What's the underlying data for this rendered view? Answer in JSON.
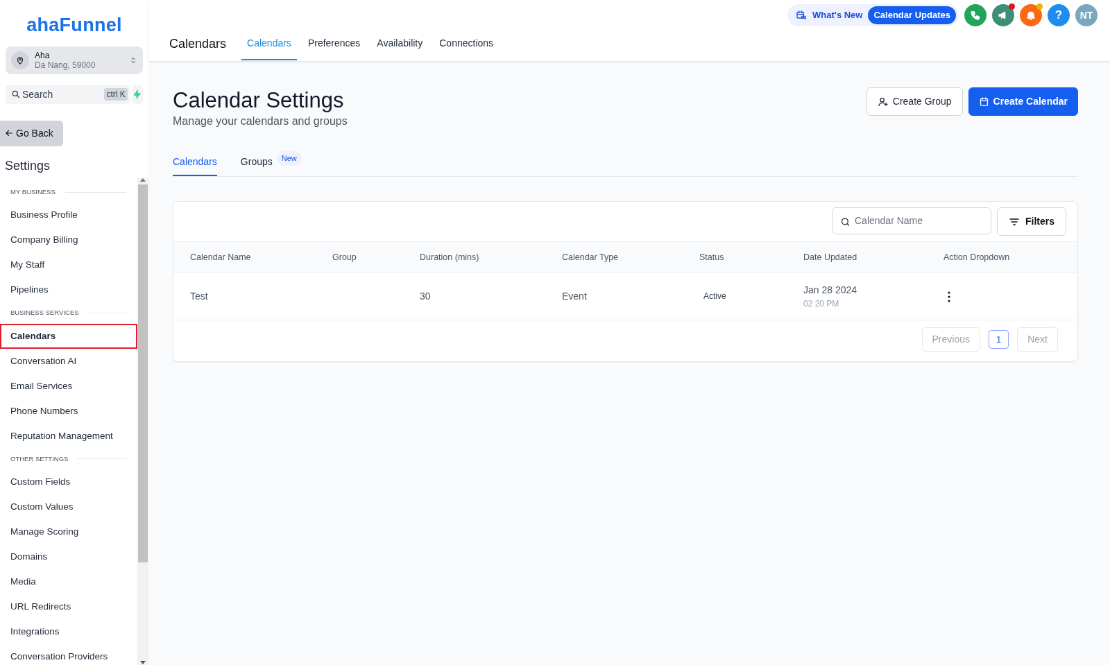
{
  "brand": {
    "logo": "ahaFunnel"
  },
  "location": {
    "name": "Aha",
    "address": "Da Nang, 59000"
  },
  "sidebar_search": {
    "placeholder": "Search",
    "shortcut": "ctrl K"
  },
  "go_back": "Go Back",
  "settings_title": "Settings",
  "sidebar": {
    "sections": [
      {
        "title": "MY BUSINESS",
        "items": [
          {
            "label": "Business Profile",
            "selected": false
          },
          {
            "label": "Company Billing",
            "selected": false
          },
          {
            "label": "My Staff",
            "selected": false
          },
          {
            "label": "Pipelines",
            "selected": false
          }
        ]
      },
      {
        "title": "BUSINESS SERVICES",
        "items": [
          {
            "label": "Calendars",
            "selected": true
          },
          {
            "label": "Conversation AI",
            "selected": false
          },
          {
            "label": "Email Services",
            "selected": false
          },
          {
            "label": "Phone Numbers",
            "selected": false
          },
          {
            "label": "Reputation Management",
            "selected": false
          }
        ]
      },
      {
        "title": "OTHER SETTINGS",
        "items": [
          {
            "label": "Custom Fields",
            "selected": false
          },
          {
            "label": "Custom Values",
            "selected": false
          },
          {
            "label": "Manage Scoring",
            "selected": false
          },
          {
            "label": "Domains",
            "selected": false
          },
          {
            "label": "Media",
            "selected": false
          },
          {
            "label": "URL Redirects",
            "selected": false
          },
          {
            "label": "Integrations",
            "selected": false
          },
          {
            "label": "Conversation Providers",
            "selected": false
          }
        ]
      }
    ]
  },
  "header": {
    "page_title": "Calendars",
    "tabs": [
      {
        "label": "Calendars",
        "selected": true
      },
      {
        "label": "Preferences",
        "selected": false
      },
      {
        "label": "Availability",
        "selected": false
      },
      {
        "label": "Connections",
        "selected": false
      }
    ],
    "whats_new": "What's New",
    "updates_badge": "Calendar Updates",
    "action_buttons": [
      {
        "kind": "phone",
        "color": "#22a55a"
      },
      {
        "kind": "megaphone",
        "color": "#3f8f78",
        "dot": {
          "color": "#e8101e"
        }
      },
      {
        "kind": "bell",
        "color": "#fa6a14",
        "dot": {
          "color": "#f5b000"
        }
      },
      {
        "kind": "help",
        "color": "#1e8cf0",
        "label": "?"
      }
    ],
    "avatar": "NT"
  },
  "main": {
    "title": "Calendar Settings",
    "subtitle": "Manage your calendars and groups",
    "buttons": [
      {
        "kind": "secondary",
        "label": "Create Group"
      },
      {
        "kind": "primary",
        "label": "Create Calendar"
      }
    ],
    "subtabs": [
      {
        "label": "Calendars",
        "selected": true
      },
      {
        "label": "Groups",
        "selected": false,
        "badge": "New"
      }
    ],
    "table_search": {
      "placeholder": "Calendar Name"
    },
    "filters": "Filters",
    "table": {
      "columns": [
        "Calendar Name",
        "Group",
        "Duration (mins)",
        "Calendar Type",
        "Status",
        "Date Updated",
        "Action Dropdown"
      ],
      "rows": [
        {
          "name": "Test",
          "group": "",
          "duration": "30",
          "type": "Event",
          "status": "Active",
          "date": "Jan 28 2024",
          "time": "02 20 PM"
        }
      ]
    },
    "pagination": {
      "previous": {
        "label": "Previous",
        "disabled": true
      },
      "pages": [
        {
          "label": "1",
          "selected": true
        }
      ],
      "next": {
        "label": "Next",
        "disabled": true
      }
    }
  }
}
